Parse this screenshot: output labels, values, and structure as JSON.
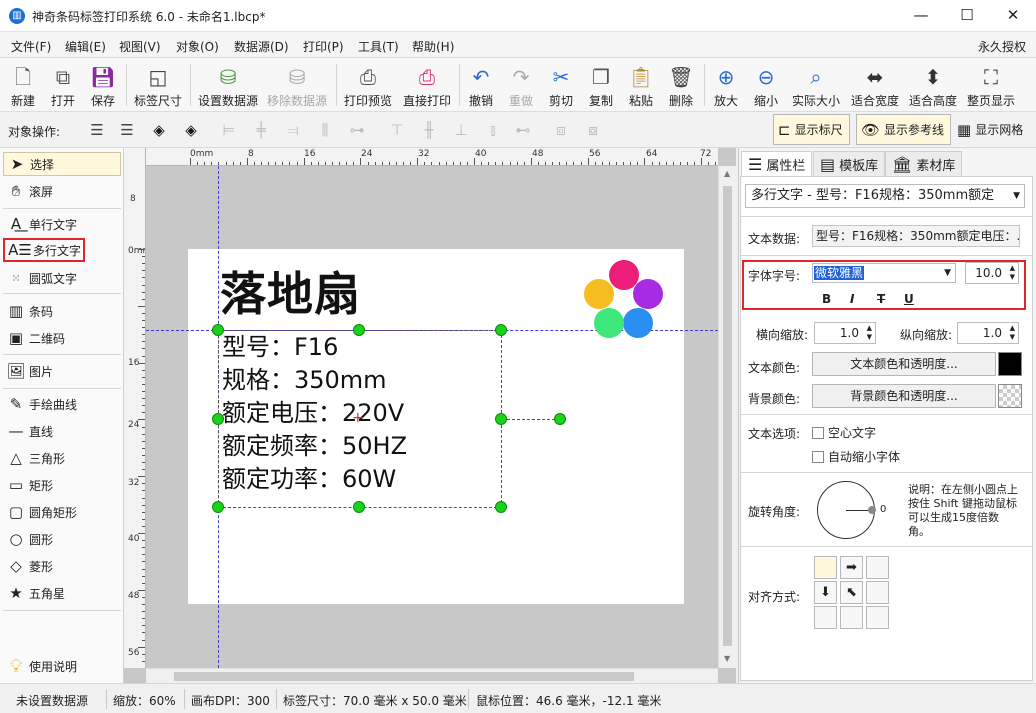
{
  "window": {
    "title": "神奇条码标签打印系统 6.0 - 未命名1.lbcp*",
    "app_icon": "barcode-app-icon",
    "minimize": "—",
    "maximize": "☐",
    "close": "✕"
  },
  "menu": {
    "items": [
      "文件(F)",
      "编辑(E)",
      "视图(V)",
      "对象(O)",
      "数据源(D)",
      "打印(P)",
      "工具(T)",
      "帮助(H)"
    ],
    "license": "永久授权"
  },
  "toolbar": {
    "items": [
      {
        "label": "新建",
        "icon": "new-file-icon",
        "enabled": true
      },
      {
        "label": "打开",
        "icon": "open-icon",
        "enabled": true
      },
      {
        "label": "保存",
        "icon": "save-icon",
        "enabled": true
      },
      {
        "label": "标签尺寸",
        "icon": "label-size-icon",
        "enabled": true
      },
      {
        "label": "设置数据源",
        "icon": "database-icon",
        "enabled": true
      },
      {
        "label": "移除数据源",
        "icon": "database-remove-icon",
        "enabled": false
      },
      {
        "label": "打印预览",
        "icon": "print-preview-icon",
        "enabled": true
      },
      {
        "label": "直接打印",
        "icon": "printer-icon",
        "enabled": true
      },
      {
        "label": "撤销",
        "icon": "undo-icon",
        "enabled": true
      },
      {
        "label": "重做",
        "icon": "redo-icon",
        "enabled": false
      },
      {
        "label": "剪切",
        "icon": "scissors-icon",
        "enabled": true
      },
      {
        "label": "复制",
        "icon": "copy-icon",
        "enabled": true
      },
      {
        "label": "粘贴",
        "icon": "paste-icon",
        "enabled": true
      },
      {
        "label": "删除",
        "icon": "trash-icon",
        "enabled": true
      },
      {
        "label": "放大",
        "icon": "zoom-in-icon",
        "enabled": true
      },
      {
        "label": "缩小",
        "icon": "zoom-out-icon",
        "enabled": true
      },
      {
        "label": "实际大小",
        "icon": "actual-size-icon",
        "enabled": true
      },
      {
        "label": "适合宽度",
        "icon": "fit-width-icon",
        "enabled": true
      },
      {
        "label": "适合高度",
        "icon": "fit-height-icon",
        "enabled": true
      },
      {
        "label": "整页显示",
        "icon": "fit-page-icon",
        "enabled": true
      }
    ]
  },
  "object_bar": {
    "label": "对象操作:",
    "show_ruler": "显示标尺",
    "show_guides": "显示参考线",
    "show_grid": "显示网格"
  },
  "tools": [
    {
      "label": "选择",
      "icon": "arrow-pointer-icon",
      "selected": true
    },
    {
      "label": "滚屏",
      "icon": "hand-icon"
    },
    {
      "label": "单行文字",
      "icon": "single-line-text-icon"
    },
    {
      "label": "多行文字",
      "icon": "multi-line-text-icon",
      "highlighted": true
    },
    {
      "label": "圆弧文字",
      "icon": "arc-text-icon"
    },
    {
      "label": "条码",
      "icon": "barcode-icon"
    },
    {
      "label": "二维码",
      "icon": "qrcode-icon"
    },
    {
      "label": "图片",
      "icon": "image-icon"
    },
    {
      "label": "手绘曲线",
      "icon": "pen-icon"
    },
    {
      "label": "直线",
      "icon": "line-icon"
    },
    {
      "label": "三角形",
      "icon": "triangle-icon"
    },
    {
      "label": "矩形",
      "icon": "rectangle-icon"
    },
    {
      "label": "圆角矩形",
      "icon": "rounded-rectangle-icon"
    },
    {
      "label": "圆形",
      "icon": "circle-icon"
    },
    {
      "label": "菱形",
      "icon": "diamond-icon"
    },
    {
      "label": "五角星",
      "icon": "star-icon"
    },
    {
      "label": "使用说明",
      "icon": "lightbulb-icon"
    }
  ],
  "rulers": {
    "h": [
      "0mm",
      "8",
      "16",
      "24",
      "32",
      "40",
      "48",
      "56",
      "64",
      "72"
    ],
    "v": [
      "0mm",
      "8",
      "16",
      "24",
      "32",
      "40",
      "48",
      "56"
    ]
  },
  "label": {
    "title": "落地扇",
    "lines": [
      "型号：F16",
      "规格：350mm",
      "额定电压：220V",
      "额定频率：50HZ",
      "额定功率：60W"
    ],
    "logo_colors": [
      "#ec1e79",
      "#a62be2",
      "#2a8ff2",
      "#3ee87a",
      "#f5bd1f"
    ]
  },
  "panel": {
    "tabs": [
      "属性栏",
      "模板库",
      "素材库"
    ],
    "object_select": "多行文字 - 型号：F16规格：350mm额定",
    "text_data_label": "文本数据:",
    "text_data_value": "型号：F16规格：350mm额定电压：...",
    "font_label": "字体字号:",
    "font_name": "微软雅黑",
    "font_size": "10.0",
    "format_buttons": [
      "B",
      "I",
      "T",
      "U"
    ],
    "hscale_label": "横向缩放:",
    "hscale": "1.0",
    "vscale_label": "纵向缩放:",
    "vscale": "1.0",
    "text_color_label": "文本颜色:",
    "text_color_button": "文本颜色和透明度...",
    "text_color": "#000000",
    "bg_color_label": "背景颜色:",
    "bg_color_button": "背景颜色和透明度...",
    "options_label": "文本选项:",
    "option_hollow": "空心文字",
    "option_autoshrink": "自动缩小字体",
    "rotation_label": "旋转角度:",
    "rotation_value": "0",
    "rotation_note": "说明：在左侧小圆点上按住 Shift 键拖动鼠标可以生成15度倍数角。",
    "align_label": "对齐方式:"
  },
  "status": {
    "datasource": "未设置数据源",
    "zoom": "缩放：60%",
    "dpi": "画布DPI：300",
    "label_size": "标签尺寸：70.0 毫米 x 50.0 毫米",
    "mouse_pos": "鼠标位置：46.6 毫米，-12.1 毫米"
  }
}
